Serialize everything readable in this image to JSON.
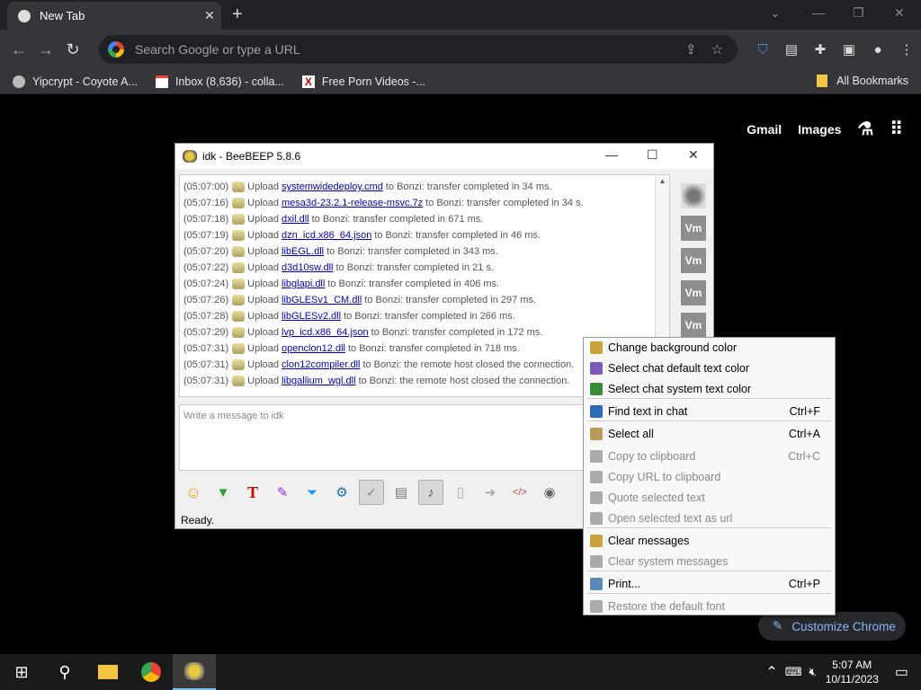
{
  "browser": {
    "tab_title": "New Tab",
    "omnibox_placeholder": "Search Google or type a URL",
    "bookmarks": [
      "Yipcrypt - Coyote A...",
      "Inbox (8,636) - colla...",
      "Free Porn Videos -..."
    ],
    "all_bookmarks": "All Bookmarks",
    "links": [
      "Gmail",
      "Images"
    ],
    "customize": "Customize Chrome"
  },
  "app": {
    "title": "idk - BeeBEEP 5.8.6",
    "chat": [
      {
        "time": "(05:07:00)",
        "pre": "Upload",
        "file": "systemwidedeploy.cmd",
        "post": "to Bonzi: transfer completed in 34 ms."
      },
      {
        "time": "(05:07:16)",
        "pre": "Upload",
        "file": "mesa3d-23.2.1-release-msvc.7z",
        "post": "to Bonzi: transfer completed in 34 s."
      },
      {
        "time": "(05:07:18)",
        "pre": "Upload",
        "file": "dxil.dll",
        "post": "to Bonzi: transfer completed in 671 ms."
      },
      {
        "time": "(05:07:19)",
        "pre": "Upload",
        "file": "dzn_icd.x86_64.json",
        "post": "to Bonzi: transfer completed in 46 ms."
      },
      {
        "time": "(05:07:20)",
        "pre": "Upload",
        "file": "libEGL.dll",
        "post": "to Bonzi: transfer completed in 343 ms."
      },
      {
        "time": "(05:07:22)",
        "pre": "Upload",
        "file": "d3d10sw.dll",
        "post": "to Bonzi: transfer completed in 21 s."
      },
      {
        "time": "(05:07:24)",
        "pre": "Upload",
        "file": "libglapi.dll",
        "post": "to Bonzi: transfer completed in 406 ms."
      },
      {
        "time": "(05:07:26)",
        "pre": "Upload",
        "file": "libGLESv1_CM.dll",
        "post": "to Bonzi: transfer completed in 297 ms."
      },
      {
        "time": "(05:07:28)",
        "pre": "Upload",
        "file": "libGLESv2.dll",
        "post": "to Bonzi: transfer completed in 266 ms."
      },
      {
        "time": "(05:07:29)",
        "pre": "Upload",
        "file": "lvp_icd.x86_64.json",
        "post": "to Bonzi: transfer completed in 172 ms."
      },
      {
        "time": "(05:07:31)",
        "pre": "Upload",
        "file": "openclon12.dll",
        "post": "to Bonzi: transfer completed in 718 ms."
      },
      {
        "time": "(05:07:31)",
        "pre": "Upload",
        "file": "clon12compiler.dll",
        "post": "to Bonzi: the remote host closed the connection."
      },
      {
        "time": "(05:07:31)",
        "pre": "Upload",
        "file": "libgallium_wgl.dll",
        "post": "to Bonzi: the remote host closed the connection."
      }
    ],
    "side_users": [
      "Vm",
      "Vm",
      "Vm",
      "Vm"
    ],
    "message_placeholder": "Write a message to idk",
    "status": "Ready."
  },
  "menu": [
    {
      "label": "Change background color",
      "shortcut": "",
      "disabled": false
    },
    {
      "label": "Select chat default text color",
      "shortcut": "",
      "disabled": false
    },
    {
      "label": "Select chat system text color",
      "shortcut": "",
      "disabled": false
    },
    {
      "label": "Find text in chat",
      "shortcut": "Ctrl+F",
      "disabled": false
    },
    {
      "label": "Select all",
      "shortcut": "Ctrl+A",
      "disabled": false
    },
    {
      "label": "Copy to clipboard",
      "shortcut": "Ctrl+C",
      "disabled": true
    },
    {
      "label": "Copy URL to clipboard",
      "shortcut": "",
      "disabled": true
    },
    {
      "label": "Quote selected text",
      "shortcut": "",
      "disabled": true
    },
    {
      "label": "Open selected text as url",
      "shortcut": "",
      "disabled": true
    },
    {
      "label": "Clear messages",
      "shortcut": "",
      "disabled": false
    },
    {
      "label": "Clear system messages",
      "shortcut": "",
      "disabled": true
    },
    {
      "label": "Print...",
      "shortcut": "Ctrl+P",
      "disabled": false
    },
    {
      "label": "Restore the default font",
      "shortcut": "",
      "disabled": true
    }
  ],
  "taskbar": {
    "time": "5:07 AM",
    "date": "10/11/2023"
  }
}
